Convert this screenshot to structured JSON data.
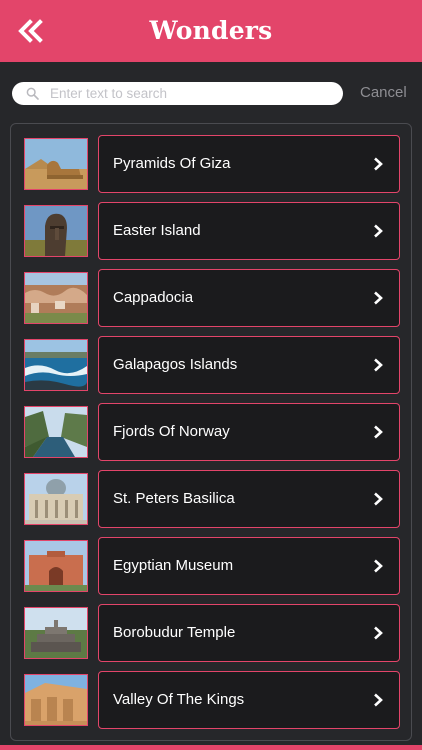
{
  "header": {
    "title": "Wonders",
    "back_icon": "double-chevron-left-icon"
  },
  "search": {
    "placeholder": "Enter text to search",
    "value": "",
    "cancel_label": "Cancel"
  },
  "colors": {
    "accent": "#e3456a",
    "background": "#26272a",
    "item_background": "#1b1b1d"
  },
  "items": [
    {
      "label": "Pyramids Of Giza",
      "thumbnail": "sphinx-desert-photo"
    },
    {
      "label": "Easter Island",
      "thumbnail": "moai-statue-photo"
    },
    {
      "label": "Cappadocia",
      "thumbnail": "rock-valley-town-photo"
    },
    {
      "label": "Galapagos Islands",
      "thumbnail": "coast-waves-photo"
    },
    {
      "label": "Fjords Of Norway",
      "thumbnail": "fjord-mountains-photo"
    },
    {
      "label": "St. Peters Basilica",
      "thumbnail": "basilica-facade-photo"
    },
    {
      "label": "Egyptian Museum",
      "thumbnail": "museum-building-photo"
    },
    {
      "label": "Borobudur Temple",
      "thumbnail": "stone-temple-photo"
    },
    {
      "label": "Valley Of The Kings",
      "thumbnail": "rock-carvings-photo"
    }
  ]
}
